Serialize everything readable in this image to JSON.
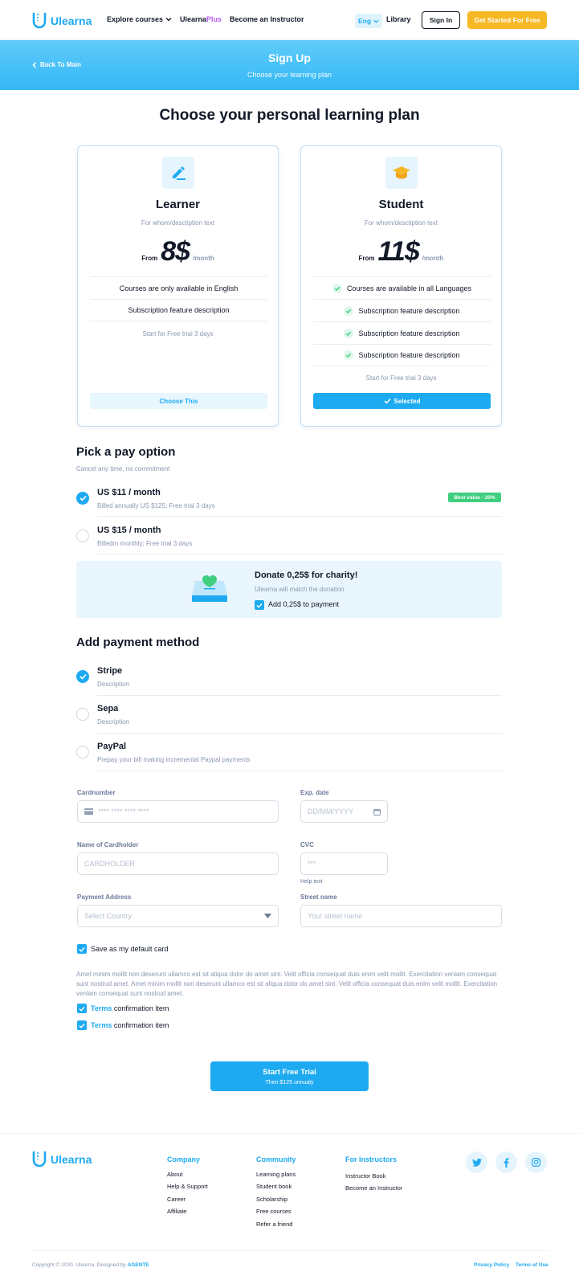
{
  "nav": {
    "brand": "Ulearna",
    "explore": "Explore courses",
    "ulearna_plus_a": "Ulearna",
    "ulearna_plus_b": "Plus",
    "become": "Become an Instructor",
    "lang": "Eng",
    "library": "Library",
    "signin": "Sign In",
    "get_started": "Get Started For Free"
  },
  "hero": {
    "back": "Back To Main",
    "title": "Sign Up",
    "subtitle": "Choose your learning plan"
  },
  "page_title": "Choose your personal learning plan",
  "plans": [
    {
      "name": "Learner",
      "desc": "For whom/desctiption text",
      "from": "From",
      "price": "8$",
      "per": "/month",
      "features": [
        "Courses are only available in English",
        "Subscription feature description"
      ],
      "trial": "Start for Free trial 3 days",
      "button": "Choose This"
    },
    {
      "name": "Student",
      "desc": "For whom/desctiption text",
      "from": "From",
      "price": "11$",
      "per": "/month",
      "features": [
        "Courses are available in all Languages",
        "Subscription feature description",
        "Subscription feature description",
        "Subscription feature description"
      ],
      "trial": "Start for Free trial 3 days",
      "button": "Selected"
    }
  ],
  "pay_option": {
    "title": "Pick a pay option",
    "subtitle": "Cancel any time, no commitment",
    "options": [
      {
        "title": "US $11 / month",
        "sub": "Billed annually US $125; Free trial 3 days",
        "badge": "Best value - 20%",
        "selected": true
      },
      {
        "title": "US $15 / month",
        "sub": "Billedm monthly; Free trial 3 days",
        "selected": false
      }
    ]
  },
  "charity": {
    "title": "Donate 0,25$ for charity!",
    "sub": "Ulearna will match the donation",
    "checkbox": "Add 0,25$ to payment"
  },
  "payment_method": {
    "title": "Add payment method",
    "methods": [
      {
        "title": "Stripe",
        "sub": "Description",
        "selected": true
      },
      {
        "title": "Sepa",
        "sub": "Description",
        "selected": false
      },
      {
        "title": "PayPal",
        "sub": "Prepay your bill making incremental Paypal payments",
        "selected": false
      }
    ]
  },
  "form": {
    "card_label": "Cardnumber",
    "card_placeholder": "**** **** **** ****",
    "exp_label": "Exp. date",
    "exp_placeholder": "DD/MM/YYYY",
    "holder_label": "Name of Cardholder",
    "holder_placeholder": "CARDHOLDER",
    "cvc_label": "CVC",
    "cvc_placeholder": "***",
    "cvc_help": "Help text",
    "address_label": "Payment Address",
    "country_placeholder": "Select Country",
    "street_label": "Street name",
    "street_placeholder": "Your street name",
    "save_default": "Save as my default card",
    "legal": "Amet minim mollit non deserunt ullamco est sit aliqua dolor do amet sint. Velit officia consequat duis enim velit mollit. Exercitation veniam consequat sunt nostrud amet. Amet minim mollit non deserunt ullamco est sit aliqua dolor do amet sint. Velit officia consequat duis enim velit mollit. Exercitation veniam consequat sunt nostrud amet.",
    "terms_word": "Terms",
    "terms_rest": "confirmation item"
  },
  "cta": {
    "title": "Start Free Trial",
    "sub": "Then $125 unnualy"
  },
  "footer": {
    "brand": "Ulearna",
    "company": {
      "title": "Company",
      "links": [
        "About",
        "Help & Support",
        "Career",
        "Affiliate"
      ]
    },
    "community": {
      "title": "Community",
      "links": [
        "Learning plans",
        "Student book",
        "Scholarship",
        "Free courses",
        "Refer a friend"
      ]
    },
    "instructors": {
      "title": "For Instructors",
      "links": [
        "Instructor Book",
        "Become an Instructor"
      ]
    },
    "copyright": "Copyright © 2020. Ulearna. Designed by",
    "designer": "AGENTE",
    "privacy": "Privacy Policy",
    "terms": "Terms of Use"
  },
  "colors": {
    "accent": "#1eaaf1",
    "cta_yellow": "#f7b825",
    "badge_green": "#3fcf7f",
    "plus_purple": "#b25cf3"
  }
}
